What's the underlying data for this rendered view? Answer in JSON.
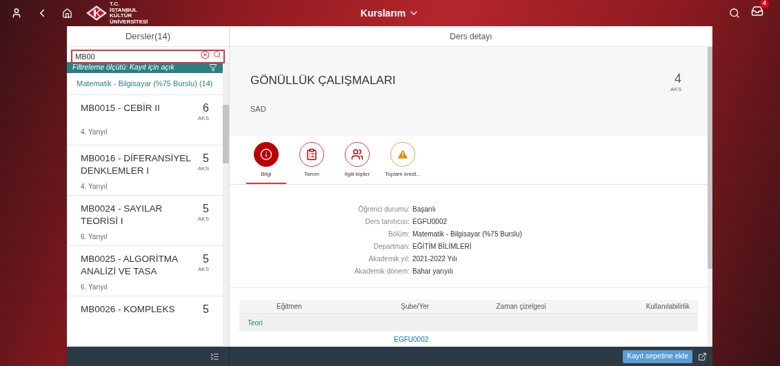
{
  "header": {
    "logo_lines": [
      "T.C.",
      "İSTANBUL",
      "KÜLTÜR",
      "ÜNİVERSİTESİ"
    ],
    "title": "Kurslarım",
    "notification_count": "4"
  },
  "list_panel": {
    "title": "Dersler(14)",
    "search": {
      "value": "MB00"
    },
    "filter": "Filtreleme ölçütü: Kayıt için açık",
    "group": "Matematik - Bilgisayar (%75 Burslu) (14)",
    "items": [
      {
        "title": "MB0015 - CEBİR II",
        "credit": "6",
        "unit": "AKS",
        "semester": "4. Yarıyıl",
        "selected": false
      },
      {
        "title": "MB0016 - DİFERANSİYEL DENKLEMLER I",
        "credit": "5",
        "unit": "AKS",
        "semester": "4. Yarıyıl",
        "selected": false
      },
      {
        "title": "MB0024 - SAYILAR TEORİSİ I",
        "credit": "5",
        "unit": "AKS",
        "semester": "6. Yarıyıl",
        "selected": false
      },
      {
        "title": "MB0025 - ALGORİTMA ANALİZİ VE TASA",
        "credit": "5",
        "unit": "AKS",
        "semester": "6. Yarıyıl",
        "selected": false
      },
      {
        "title": "MB0026 - KOMPLEKS",
        "credit": "5",
        "selected": false
      }
    ]
  },
  "detail": {
    "title": "Ders detayı",
    "course_name": "GÖNÜLLÜK ÇALIŞMALARI",
    "credit": "4",
    "unit": "AKS",
    "subtitle": "SAD",
    "tabs": [
      {
        "label": "Bilgi",
        "kind": "info",
        "selected": true
      },
      {
        "label": "Tanım",
        "kind": "notes",
        "selected": false
      },
      {
        "label": "İlgili kişiler",
        "kind": "people",
        "selected": false
      },
      {
        "label": "Toplam kredi...",
        "kind": "warning",
        "selected": false
      }
    ],
    "fields": [
      {
        "label": "Öğrenci durumu:",
        "value": "Başarılı"
      },
      {
        "label": "Ders tanıtıcısı:",
        "value": "EGFU0002"
      },
      {
        "label": "Bölüm:",
        "value": "Matematik - Bilgisayar (%75 Burslu)"
      },
      {
        "label": "Departman:",
        "value": "EĞİTİM BİLİMLERİ"
      },
      {
        "label": "Akademik yıl:",
        "value": "2021-2022 Yılı"
      },
      {
        "label": "Akademik dönem:",
        "value": "Bahar yarıyılı"
      }
    ],
    "table": {
      "columns": [
        "Eğitmen",
        "Şube/Yer",
        "Zaman çizelgesi",
        "Kullanılabilirlik"
      ],
      "group": "Teori",
      "rows": [
        {
          "section": "EGFU0002"
        }
      ]
    }
  },
  "footer": {
    "button": "Kayıt sepetine ekle"
  }
}
